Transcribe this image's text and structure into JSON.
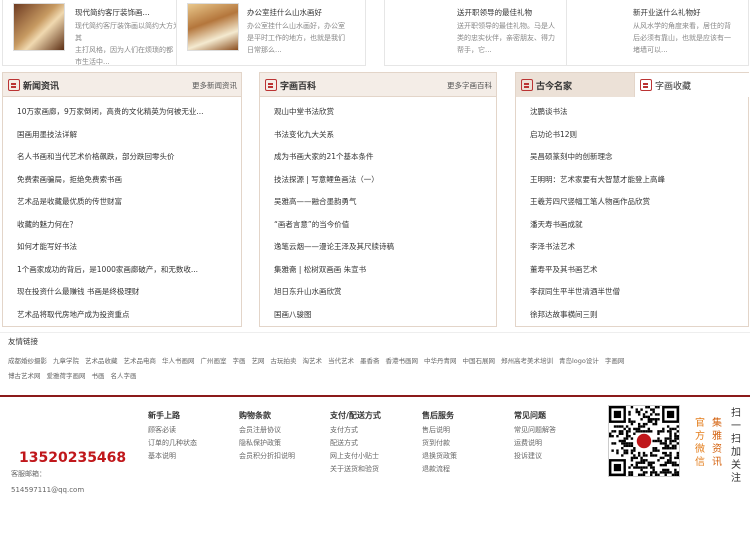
{
  "top_cards": [
    {
      "title": "现代简约客厅装饰画...",
      "desc": [
        "现代简约客厅装饰画以简约大方为其",
        "主打风格，因为人们在烦琐的都",
        "市生活中..."
      ]
    },
    {
      "title": "办公室挂什么山水画好",
      "desc": [
        "办公室挂什么山水画好，办公室",
        "是平时工作的地方，也就是我们",
        "日常那么..."
      ]
    },
    {
      "title": "送开职领导的最佳礼物",
      "desc": [
        "送开职领导的最佳礼物。马是人",
        "类的忠实伙伴，亲密朋友、得力",
        "帮手，它..."
      ]
    },
    {
      "title": "新开业送什么礼物好",
      "desc": [
        "从风水学的角度来看，居住的背",
        "后必须有靠山，也就是应该有一",
        "堵墙可以..."
      ]
    }
  ],
  "news_panel": {
    "title": "新闻资讯",
    "more": "更多新闻资讯",
    "items": [
      "10万家画廊，9万家倒闭，高贵的文化精英为何被无业...",
      "国画用墨技法详解",
      "名人书画和当代艺术价格飙跌，部分跌回零头价",
      "免费索画骗局，拒绝免费索书画",
      "艺术品是收藏最优质的传世财富",
      "收藏的魅力何在？",
      "如何才能写好书法",
      "1个画家成功的背后，是1000家画廊破产，和无数收...",
      "现在投资什么最赚钱 书画是终极理财",
      "艺术品将取代房地产成为投资重点"
    ]
  },
  "art_panel": {
    "title": "字画百科",
    "more": "更多字画百科",
    "items": [
      "观山中堂书法欣赏",
      "书法变化九大关系",
      "成为书画大家的21个基本条件",
      "技法探源 | 写意鲤鱼画法（一）",
      "吴雅高——融合墨韵勇气",
      "“画者言意”的当今价值",
      "逸笔云烟——漫论王泽及其尺牍诗稿",
      "集雅斋 | 松树双画画  朱宣书",
      "旭日东升山水画欣赏",
      "国画八骏图"
    ]
  },
  "famous_panel": {
    "tab1": "古今名家",
    "tab2": "字画收藏",
    "items": [
      "沈鹏谈书法",
      "启功论书12则",
      "吴昌硕篆刻中的创新理念",
      "王明明：艺术家要有大智慧才能登上高峰",
      "王羲芳四尺竖幅工笔人物画作品欣赏",
      "潘天寿书画成就",
      "李泽书法艺术",
      "董寿平及其书画艺术",
      "李叔同生平半世清酒半世僧",
      "徐邦达故事横间三则"
    ]
  },
  "links": {
    "title": "友情链接",
    "row1": [
      "成都婚纱摄影",
      "九章学院",
      "艺术品收藏",
      "艺术品电商",
      "华人书画网",
      "广州画室",
      "字画",
      "艺网",
      "古玩拍卖",
      "淘艺术",
      "当代艺术",
      "墨香斋",
      "香港书画网",
      "中华丹青网",
      "中国石展网",
      "郑州高考美术培训",
      "青岛logo设计",
      "字画网"
    ],
    "row2": [
      "博古艺术网",
      "爱雅荷字画网",
      "书画",
      "名人字画"
    ]
  },
  "footer": {
    "phone": "13520235468",
    "email_label": "客服邮箱：",
    "email": "514597111@qq.com",
    "columns": [
      {
        "title": "新手上路",
        "items": [
          "顾客必读",
          "订单的几种状态",
          "基本说明"
        ]
      },
      {
        "title": "购物条款",
        "items": [
          "会员注册协议",
          "隐私保护政策",
          "会员积分折扣说明"
        ]
      },
      {
        "title": "支付/配送方式",
        "items": [
          "支付方式",
          "配送方式",
          "网上支付小贴士",
          "关于送货和验货"
        ]
      },
      {
        "title": "售后服务",
        "items": [
          "售后说明",
          "货到付款",
          "退换货政策",
          "退款流程"
        ]
      },
      {
        "title": "常见问题",
        "items": [
          "常见问题解答",
          "运费说明",
          "投诉建议"
        ]
      }
    ],
    "wechat_a": "官方微信",
    "wechat_b": "集雅资讯",
    "scan": "扫一扫加关注"
  }
}
